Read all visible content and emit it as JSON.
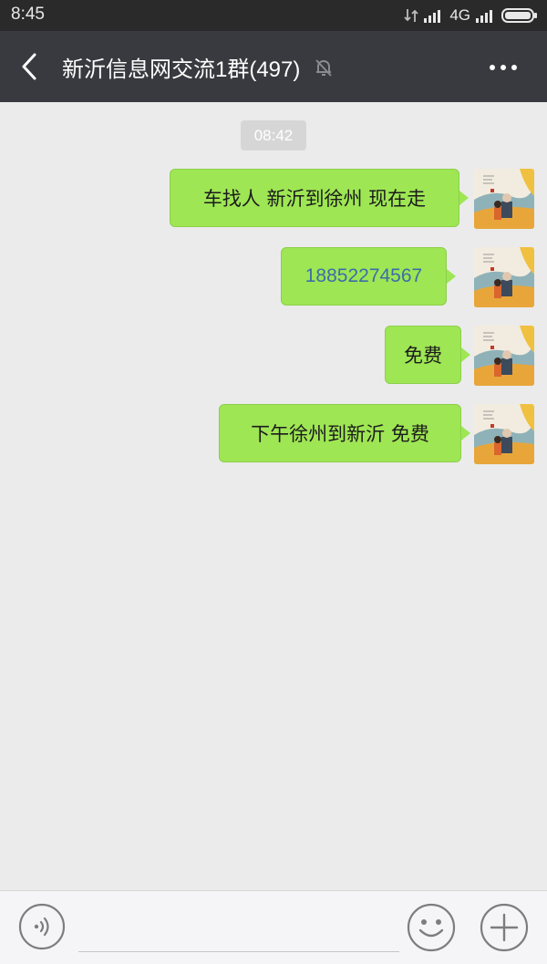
{
  "status_bar": {
    "time": "8:45",
    "network": "4G",
    "icons": [
      "data-arrows-icon",
      "signal-icon",
      "signal-icon",
      "battery-icon"
    ]
  },
  "header": {
    "title": "新沂信息网交流1群(497)",
    "back_icon": "back-arrow-icon",
    "mute_icon": "muted-bell-icon",
    "more_icon": "more-dots-icon"
  },
  "chat": {
    "timestamp": "08:42",
    "messages": [
      {
        "text": "车找人  新沂到徐州  现在走",
        "sender": "self",
        "kind": "text"
      },
      {
        "text": "18852274567",
        "sender": "self",
        "kind": "phone"
      },
      {
        "text": "免费",
        "sender": "self",
        "kind": "text"
      },
      {
        "text": "下午徐州到新沂   免费",
        "sender": "self",
        "kind": "text"
      }
    ]
  },
  "composer": {
    "voice_icon": "voice-icon",
    "emoji_icon": "emoji-icon",
    "plus_icon": "plus-icon",
    "input_value": ""
  },
  "colors": {
    "bubble": "#9ee654",
    "titlebar": "#393a3f",
    "background": "#ebebeb",
    "phone_link": "#3b6ea8"
  }
}
